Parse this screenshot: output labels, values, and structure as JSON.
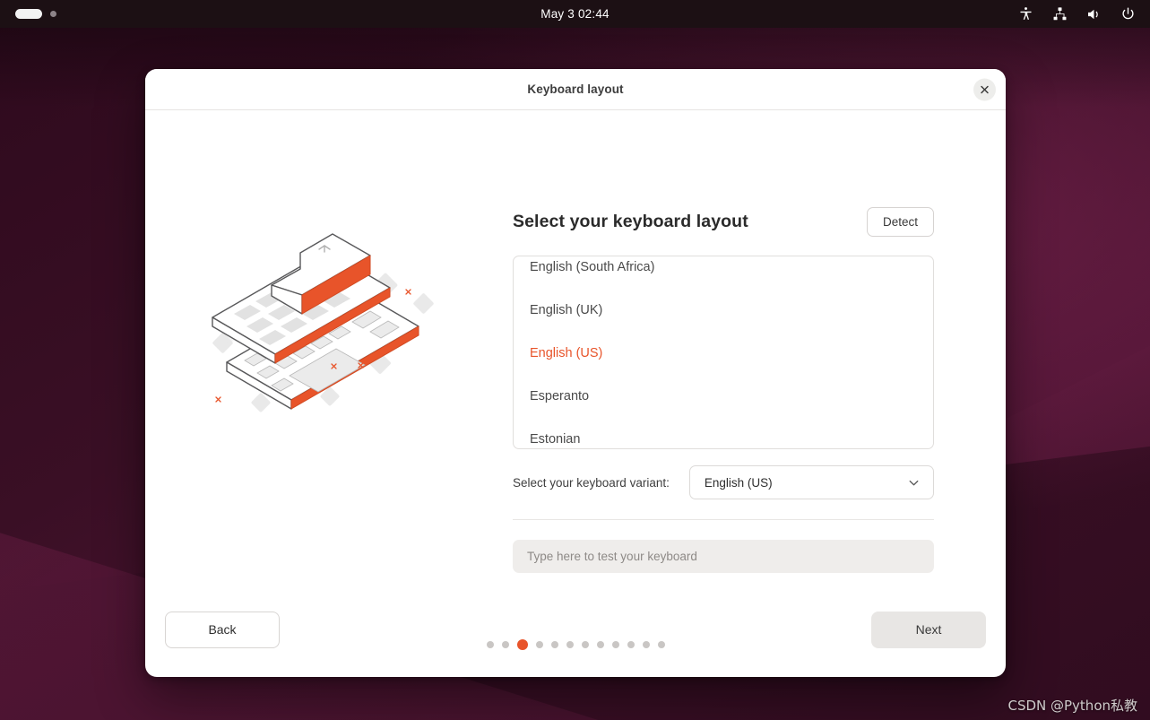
{
  "topbar": {
    "clock": "May 3  02:44",
    "window_indicator": "window-pill",
    "icons": [
      {
        "name": "accessibility-icon",
        "label": "Accessibility"
      },
      {
        "name": "network-icon",
        "label": "Network"
      },
      {
        "name": "volume-icon",
        "label": "Volume"
      },
      {
        "name": "power-icon",
        "label": "Power"
      }
    ]
  },
  "window": {
    "title": "Keyboard layout",
    "close_label": "Close"
  },
  "main": {
    "heading": "Select your keyboard layout",
    "detect_label": "Detect",
    "layouts": [
      {
        "label": "English (South Africa)",
        "selected": false
      },
      {
        "label": "English (UK)",
        "selected": false
      },
      {
        "label": "English (US)",
        "selected": true
      },
      {
        "label": "Esperanto",
        "selected": false
      },
      {
        "label": "Estonian",
        "selected": false
      }
    ],
    "variant_label": "Select your keyboard variant:",
    "variant_value": "English (US)",
    "test_placeholder": "Type here to test your keyboard",
    "test_value": ""
  },
  "footer": {
    "back_label": "Back",
    "next_label": "Next",
    "total_steps": 12,
    "current_step": 3
  },
  "watermark": "CSDN @Python私教",
  "colors": {
    "accent": "#e8542a",
    "wallpaper_dark": "#2e0a1d",
    "wallpaper_light": "#76214d",
    "topbar": "#1c1014",
    "dot_inactive": "#c9c6c4"
  }
}
